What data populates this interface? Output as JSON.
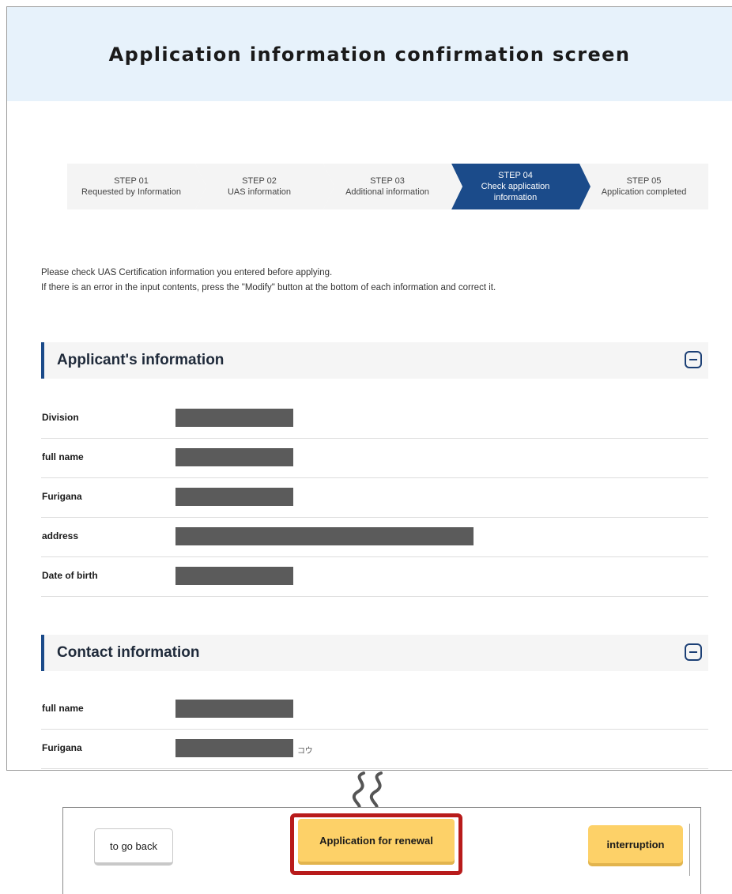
{
  "page": {
    "title": "Application information confirmation screen"
  },
  "steps": [
    {
      "num": "STEP 01",
      "label": "Requested by Information",
      "active": false
    },
    {
      "num": "STEP 02",
      "label": "UAS information",
      "active": false
    },
    {
      "num": "STEP 03",
      "label": "Additional information",
      "active": false
    },
    {
      "num": "STEP 04",
      "label": "Check application information",
      "active": true
    },
    {
      "num": "STEP 05",
      "label": "Application completed",
      "active": false
    }
  ],
  "intro": {
    "line1": "Please check UAS Certification information you entered before applying.",
    "line2": "If there is an error in the input contents, press the \"Modify\" button at the bottom of each information and correct it."
  },
  "applicant": {
    "title": "Applicant's information",
    "rows": [
      {
        "label": "Division"
      },
      {
        "label": "full name"
      },
      {
        "label": "Furigana"
      },
      {
        "label": "address"
      },
      {
        "label": "Date of birth"
      }
    ]
  },
  "contact": {
    "title": "Contact information",
    "rows": [
      {
        "label": "full name"
      },
      {
        "label": "Furigana",
        "suffix": "コウ"
      }
    ]
  },
  "actions": {
    "back_label": "to go back",
    "renew_label": "Application for renewal",
    "interrupt_label": "interruption"
  },
  "colors": {
    "accent": "#1b4b8a",
    "header_bg": "#e7f2fb",
    "button_yellow": "#fdd168",
    "highlight_red": "#b81b1b",
    "redaction": "#5b5b5b"
  }
}
